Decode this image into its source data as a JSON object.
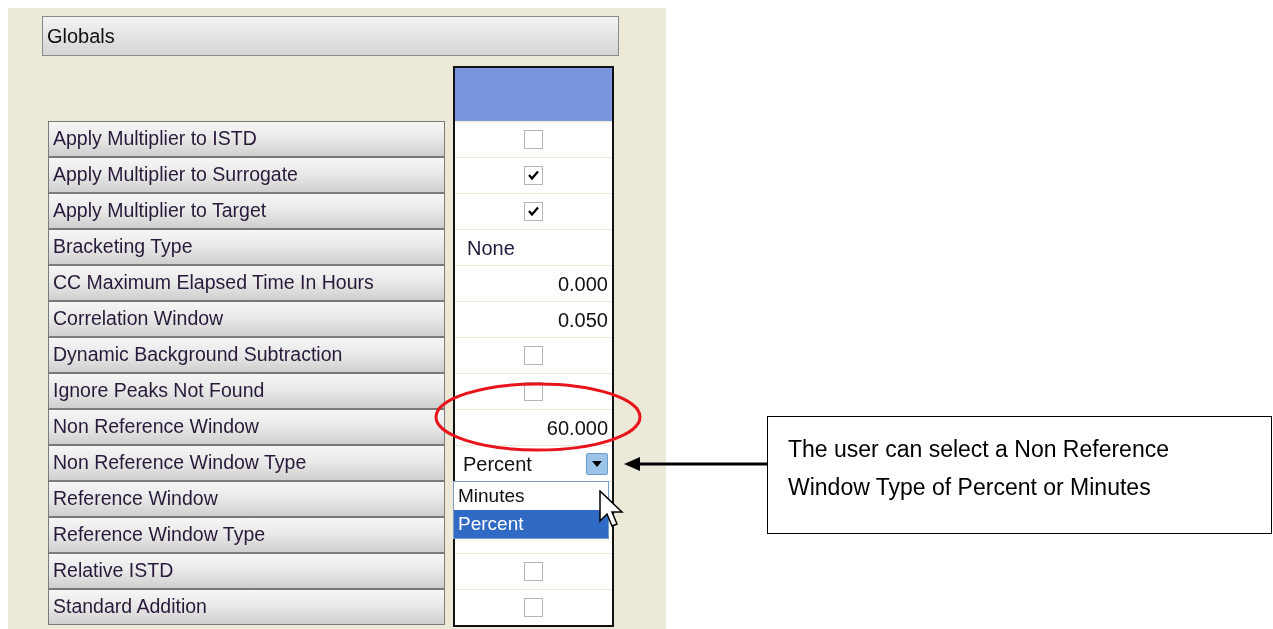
{
  "section": {
    "title": "Globals"
  },
  "rows": [
    {
      "label": "Apply Multiplier to ISTD",
      "kind": "checkbox",
      "checked": false
    },
    {
      "label": "Apply Multiplier to Surrogate",
      "kind": "checkbox",
      "checked": true
    },
    {
      "label": "Apply Multiplier to Target",
      "kind": "checkbox",
      "checked": true
    },
    {
      "label": "Bracketing Type",
      "kind": "text",
      "value": "None"
    },
    {
      "label": "CC Maximum Elapsed Time In Hours",
      "kind": "number",
      "value": "0.000"
    },
    {
      "label": "Correlation Window",
      "kind": "number",
      "value": "0.050"
    },
    {
      "label": "Dynamic Background Subtraction",
      "kind": "checkbox",
      "checked": false
    },
    {
      "label": "Ignore Peaks Not Found",
      "kind": "checkbox",
      "checked": false
    },
    {
      "label": "Non Reference Window",
      "kind": "number",
      "value": "60.000",
      "highlighted": true
    },
    {
      "label": "Non Reference Window Type",
      "kind": "dropdown",
      "value": "Percent",
      "expanded": true,
      "options": [
        {
          "label": "Minutes",
          "selected": false
        },
        {
          "label": "Percent",
          "selected": true
        }
      ]
    },
    {
      "label": "Reference Window",
      "kind": "covered"
    },
    {
      "label": "Reference Window Type",
      "kind": "covered"
    },
    {
      "label": "Relative ISTD",
      "kind": "checkbox",
      "checked": false
    },
    {
      "label": "Standard Addition",
      "kind": "checkbox",
      "checked": false
    }
  ],
  "callout": {
    "text": "The user can select a Non Reference Window Type of Percent or Minutes"
  }
}
